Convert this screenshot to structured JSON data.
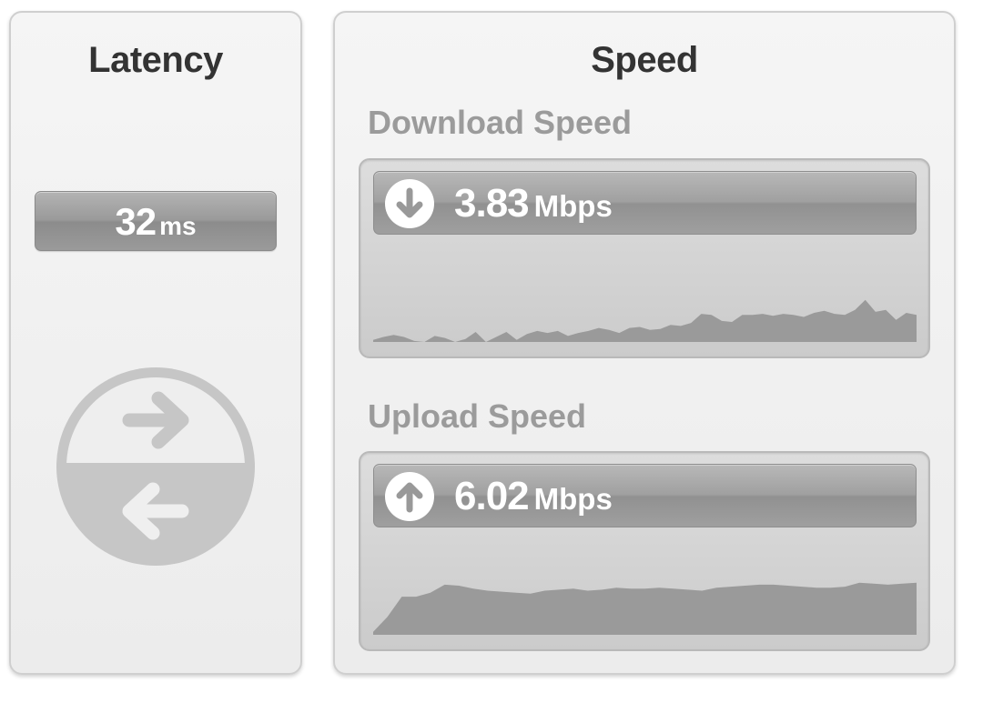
{
  "latency": {
    "title": "Latency",
    "value": "32",
    "unit": "ms"
  },
  "speed": {
    "title": "Speed",
    "download": {
      "label": "Download Speed",
      "value": "3.83",
      "unit": "Mbps",
      "history": [
        0.02,
        0.05,
        0.07,
        0.05,
        0.01,
        0.0,
        0.06,
        0.04,
        0.0,
        0.03,
        0.1,
        0.0,
        0.05,
        0.1,
        0.02,
        0.08,
        0.11,
        0.09,
        0.11,
        0.06,
        0.09,
        0.11,
        0.14,
        0.12,
        0.09,
        0.14,
        0.15,
        0.12,
        0.13,
        0.17,
        0.16,
        0.19,
        0.28,
        0.27,
        0.21,
        0.2,
        0.27,
        0.27,
        0.28,
        0.26,
        0.28,
        0.27,
        0.25,
        0.29,
        0.31,
        0.28,
        0.27,
        0.32,
        0.42,
        0.3,
        0.32,
        0.22,
        0.29,
        0.27
      ]
    },
    "upload": {
      "label": "Upload Speed",
      "value": "6.02",
      "unit": "Mbps",
      "history": [
        0.03,
        0.18,
        0.38,
        0.38,
        0.42,
        0.5,
        0.49,
        0.46,
        0.44,
        0.43,
        0.42,
        0.41,
        0.44,
        0.45,
        0.46,
        0.44,
        0.45,
        0.47,
        0.46,
        0.46,
        0.47,
        0.46,
        0.45,
        0.44,
        0.47,
        0.48,
        0.49,
        0.5,
        0.5,
        0.49,
        0.48,
        0.47,
        0.47,
        0.48,
        0.52,
        0.51,
        0.5,
        0.51,
        0.52
      ]
    }
  },
  "colors": {
    "graph_fill": "#9a9a9a",
    "bar_gray": "#999999",
    "label_gray": "#9b9b9b",
    "latency_icon": "#c6c6c6"
  },
  "icons": {
    "download": "arrow-down-circle-icon",
    "upload": "arrow-up-circle-icon",
    "latency": "round-trip-arrows-icon"
  }
}
